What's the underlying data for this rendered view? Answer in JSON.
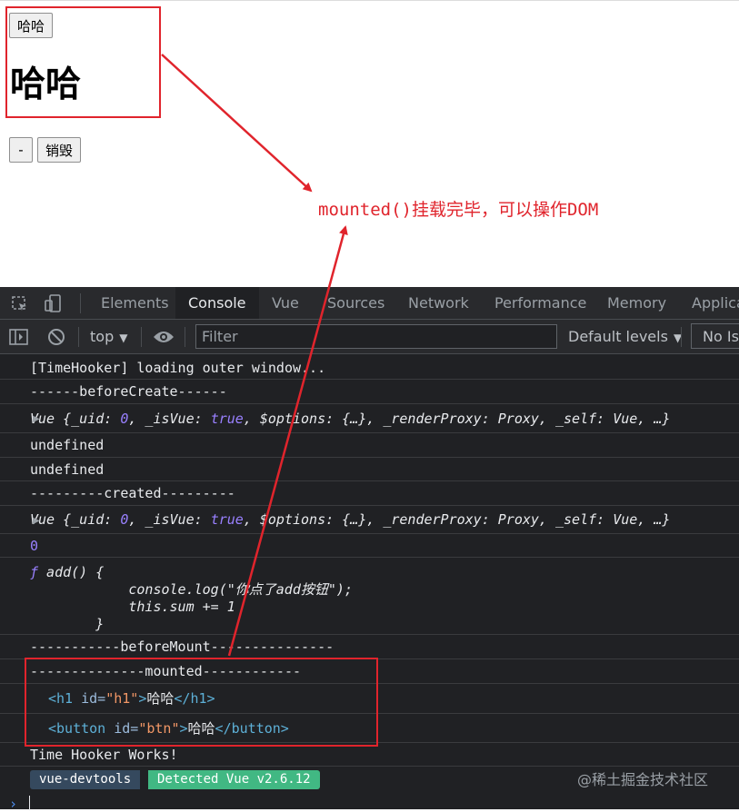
{
  "page": {
    "button_top": "哈哈",
    "heading": "哈哈",
    "minus_button": "-",
    "destroy_button": "销毁"
  },
  "annotation": "mounted()挂载完毕，可以操作DOM",
  "devtools": {
    "tabs": [
      "Elements",
      "Console",
      "Vue",
      "Sources",
      "Network",
      "Performance",
      "Memory",
      "Applica"
    ],
    "toolbar": {
      "context": "top",
      "filter_placeholder": "Filter",
      "levels": "Default levels",
      "issues": "No Iss"
    },
    "console": {
      "timehooker": "[TimeHooker] loading outer window...",
      "before_create": "------beforeCreate------",
      "vue_obj_prefix": "Vue {_uid: ",
      "vue_uid": "0",
      "vue_mid1": ", _isVue: ",
      "vue_true": "true",
      "vue_mid2": ", $options: {…}, _renderProxy: Proxy, _self: Vue, …}",
      "undefined1": "undefined",
      "undefined2": "undefined",
      "created": "---------created---------",
      "zero": "0",
      "fn_f": "ƒ",
      "fn_line1": " add() {",
      "fn_line2": "            console.log(\"你点了add按钮\");",
      "fn_line3": "            this.sum += 1",
      "fn_line4": "        }",
      "before_mount": "-----------beforeMount---------------",
      "mounted": "--------------mounted------------",
      "h1_open_lt": "<h1",
      "h1_attr": " id=",
      "h1_val": "\"h1\"",
      "h1_gt": ">",
      "h1_text": "哈哈",
      "h1_close": "</h1>",
      "btn_open_lt": "<button",
      "btn_attr": " id=",
      "btn_val": "\"btn\"",
      "btn_gt": ">",
      "btn_text": "哈哈",
      "btn_close": "</button>",
      "time_hooker_works": "Time Hooker Works!",
      "badge_left": "vue-devtools",
      "badge_right": "Detected Vue v2.6.12"
    }
  },
  "watermark": "@稀土掘金技术社区",
  "colors": {
    "annotation_red": "#e0242c",
    "devtools_bg": "#202124",
    "vue_green": "#41b883"
  }
}
